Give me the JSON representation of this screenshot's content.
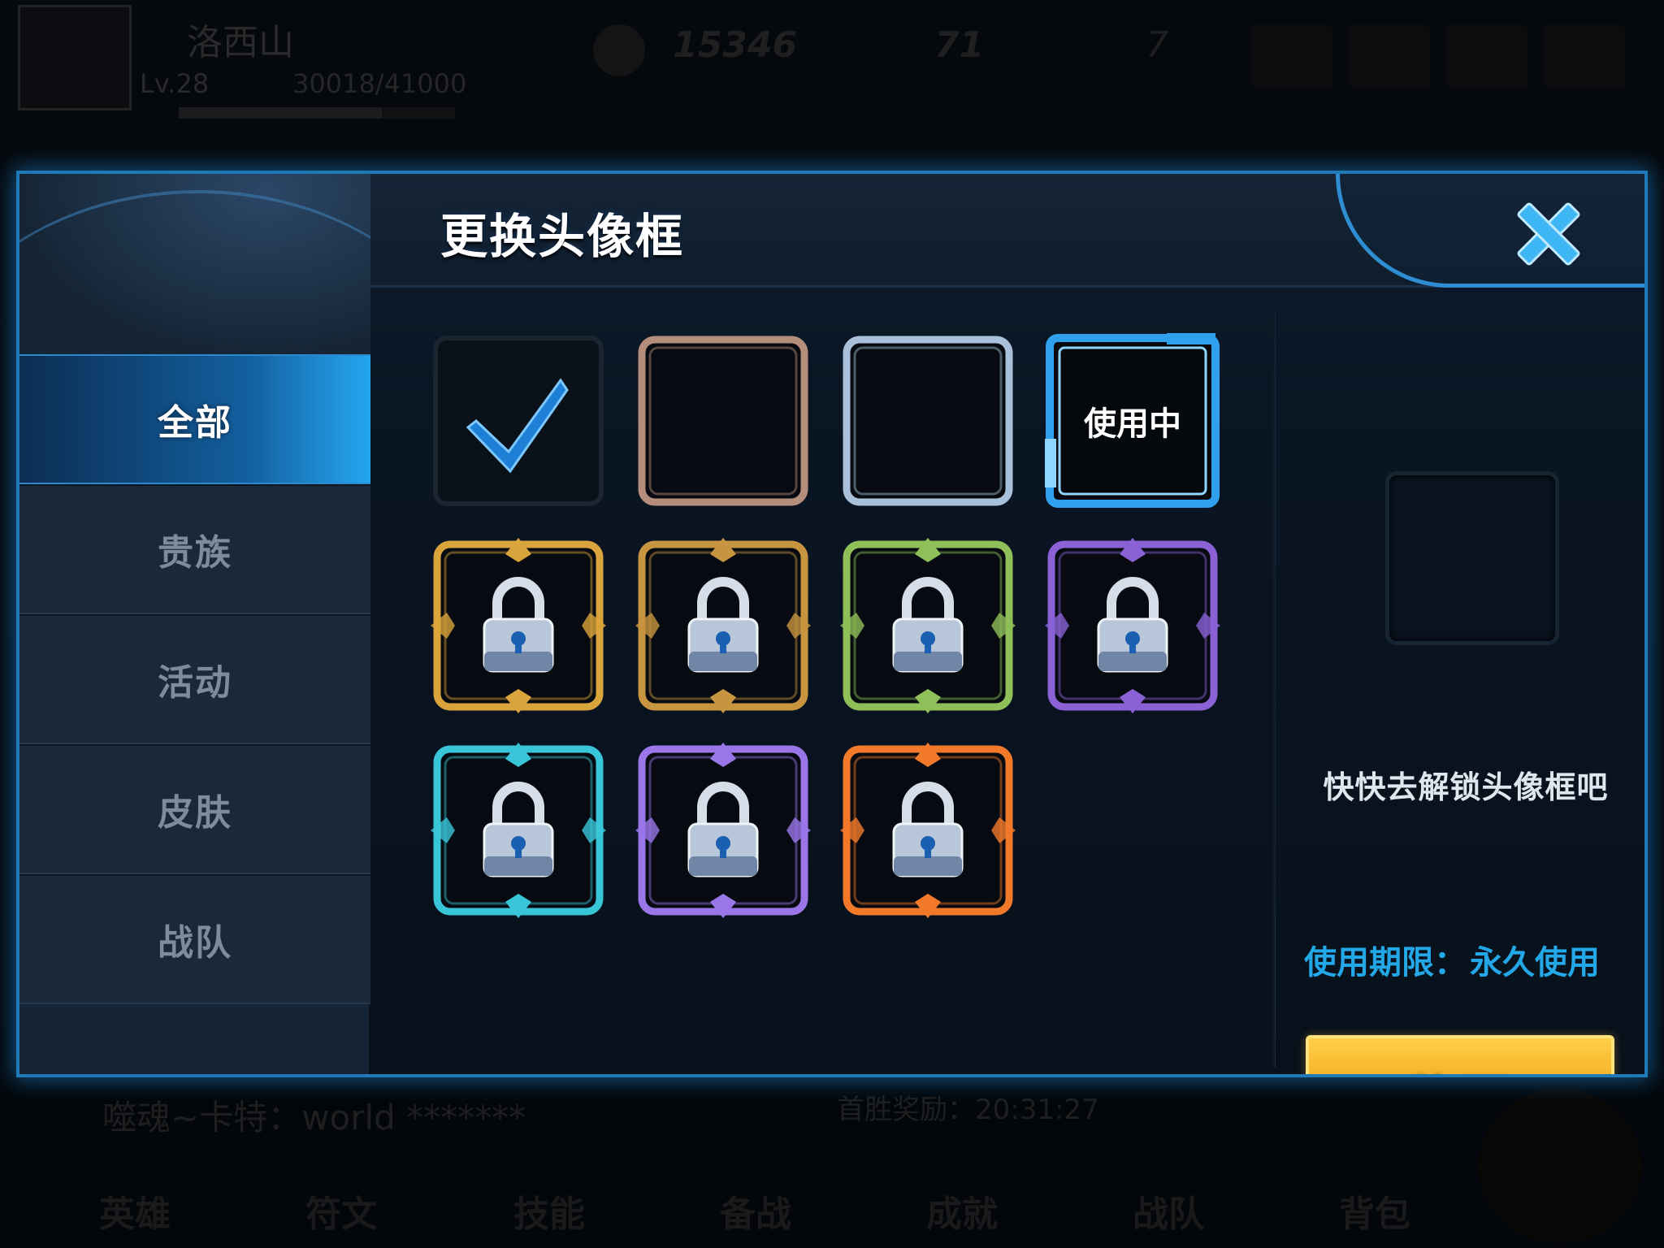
{
  "background": {
    "player_name": "洛西山",
    "level": "Lv.28",
    "exp": "30018/41000",
    "coins": "15346",
    "diamonds": "71",
    "tickets": "7",
    "chat_message": "噬魂~卡特：world *******",
    "stamp_text": "首胜奖励：20:31:27",
    "nav": [
      "英雄",
      "符文",
      "技能",
      "备战",
      "成就",
      "战队",
      "背包"
    ]
  },
  "dialog": {
    "title": "更换头像框",
    "close_icon": "close-x-icon",
    "categories": [
      {
        "label": "全部",
        "active": true
      },
      {
        "label": "贵族",
        "active": false
      },
      {
        "label": "活动",
        "active": false
      },
      {
        "label": "皮肤",
        "active": false
      },
      {
        "label": "战队",
        "active": false
      }
    ],
    "frames": [
      {
        "id": "default",
        "state": "selected",
        "color": "#1b2431",
        "icon": "checkmark-icon"
      },
      {
        "id": "bronze",
        "state": "unlocked",
        "color": "#b58e7b"
      },
      {
        "id": "silver",
        "state": "unlocked",
        "color": "#a9c0da"
      },
      {
        "id": "blue",
        "state": "in-use",
        "color": "#2ea0ec",
        "label": "使用中"
      },
      {
        "id": "gold",
        "state": "locked",
        "color": "#d9a43b",
        "icon": "lock-icon"
      },
      {
        "id": "bronze-wing",
        "state": "locked",
        "color": "#c79540",
        "icon": "lock-icon"
      },
      {
        "id": "green",
        "state": "locked",
        "color": "#8fbf58",
        "icon": "lock-icon"
      },
      {
        "id": "purple",
        "state": "locked",
        "color": "#8a62d6",
        "icon": "lock-icon"
      },
      {
        "id": "cyan-gold",
        "state": "locked",
        "color": "#38c5d8",
        "icon": "lock-icon"
      },
      {
        "id": "violet",
        "state": "locked",
        "color": "#9a76e8",
        "icon": "lock-icon"
      },
      {
        "id": "flame",
        "state": "locked",
        "color": "#f2792a",
        "icon": "lock-icon"
      }
    ],
    "detail": {
      "hint": "快快去解锁头像框吧",
      "duration_label": "使用期限：",
      "duration_value": "永久使用",
      "use_button": "使用"
    },
    "accent_color": "#2ea0ec",
    "button_color": "#f3a91d"
  }
}
